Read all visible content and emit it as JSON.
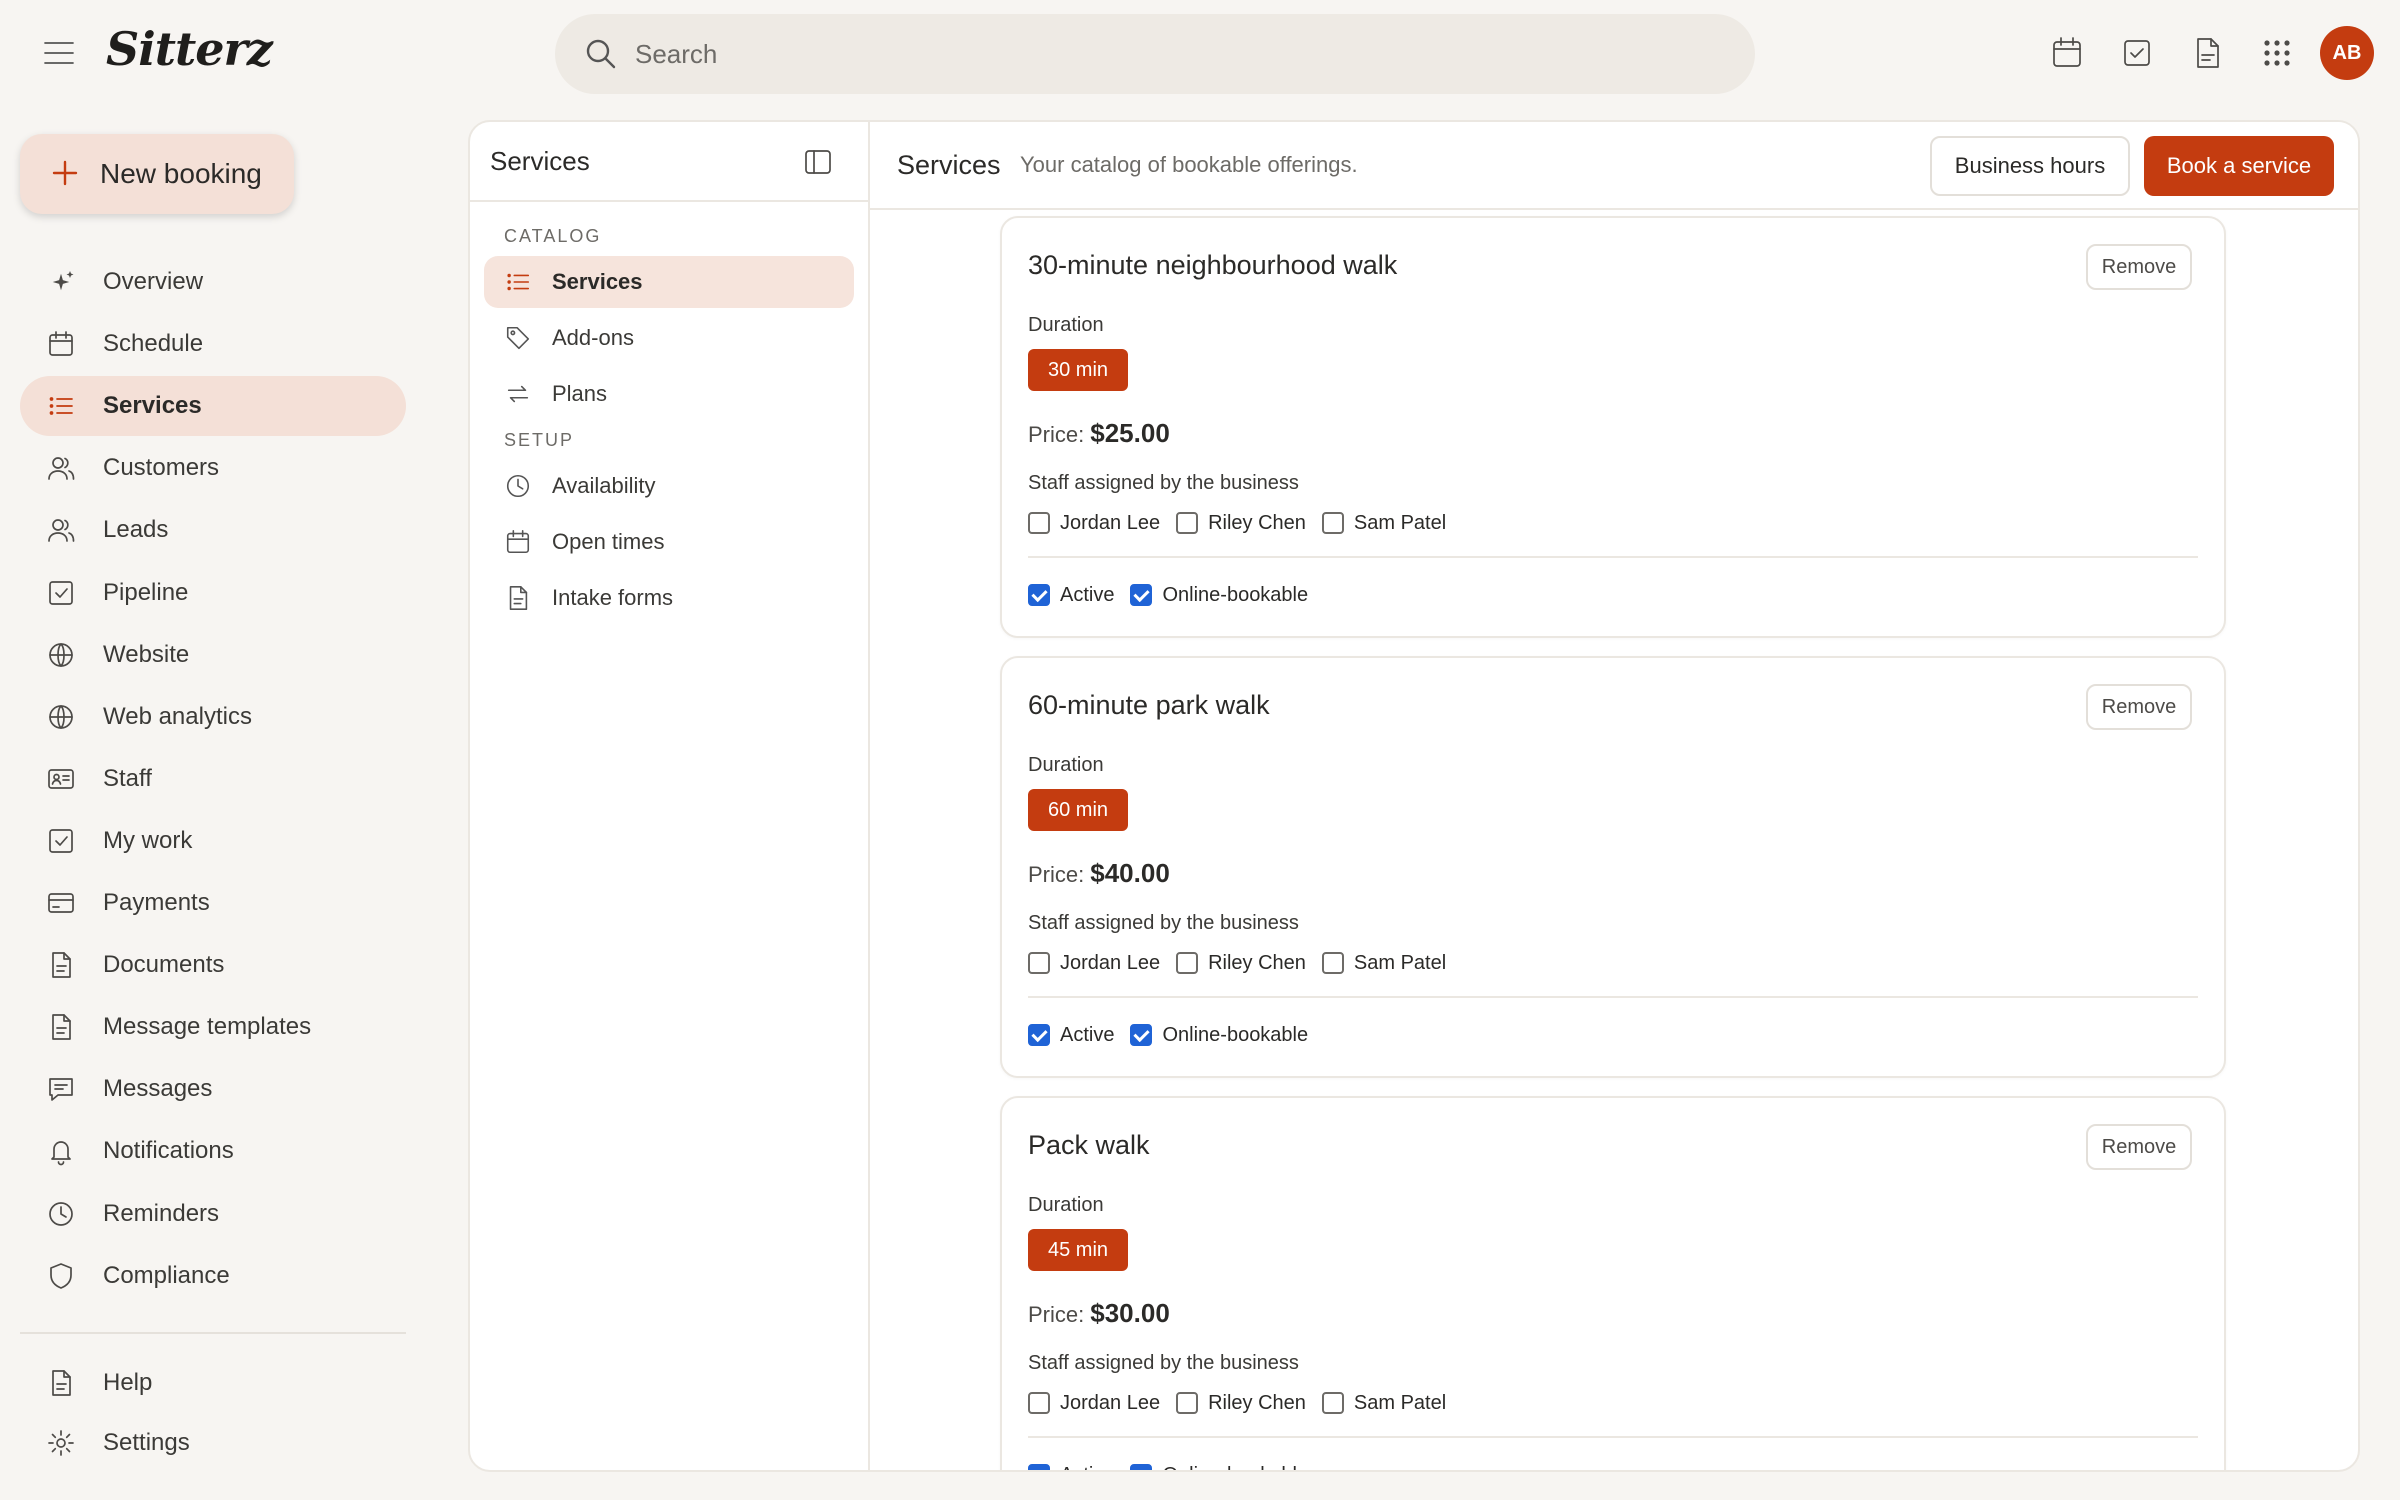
{
  "app": {
    "logo": "Sitterz",
    "user_initials": "AB"
  },
  "colors": {
    "accent": "#c43c10",
    "accent_soft": "#f4e0d7",
    "checkbox_checked": "#1f63d6",
    "background": "#f7f5f2"
  },
  "search": {
    "placeholder": "Search"
  },
  "topbar_icons": [
    "calendar-icon",
    "task-check-icon",
    "document-icon",
    "apps-grid-icon"
  ],
  "new_booking": {
    "label": "New booking"
  },
  "nav": {
    "items": [
      {
        "label": "Overview",
        "icon": "sparkle-icon"
      },
      {
        "label": "Schedule",
        "icon": "calendar-icon"
      },
      {
        "label": "Services",
        "icon": "list-icon",
        "active": true
      },
      {
        "label": "Customers",
        "icon": "people-icon"
      },
      {
        "label": "Leads",
        "icon": "people-icon"
      },
      {
        "label": "Pipeline",
        "icon": "check-square-icon"
      },
      {
        "label": "Website",
        "icon": "globe-icon"
      },
      {
        "label": "Web analytics",
        "icon": "globe-icon"
      },
      {
        "label": "Staff",
        "icon": "id-card-icon"
      },
      {
        "label": "My work",
        "icon": "check-square-icon"
      },
      {
        "label": "Payments",
        "icon": "credit-card-icon"
      },
      {
        "label": "Documents",
        "icon": "document-icon"
      },
      {
        "label": "Message templates",
        "icon": "document-icon"
      },
      {
        "label": "Messages",
        "icon": "message-icon"
      },
      {
        "label": "Notifications",
        "icon": "bell-icon"
      },
      {
        "label": "Reminders",
        "icon": "clock-icon"
      },
      {
        "label": "Compliance",
        "icon": "shield-icon"
      }
    ],
    "footer": [
      {
        "label": "Help",
        "icon": "document-icon"
      },
      {
        "label": "Settings",
        "icon": "gear-icon"
      }
    ]
  },
  "subnav": {
    "title": "Services",
    "sections": [
      {
        "label": "CATALOG",
        "items": [
          {
            "label": "Services",
            "icon": "list-icon",
            "active": true
          },
          {
            "label": "Add-ons",
            "icon": "tag-icon"
          },
          {
            "label": "Plans",
            "icon": "repeat-icon"
          }
        ]
      },
      {
        "label": "SETUP",
        "items": [
          {
            "label": "Availability",
            "icon": "clock-icon"
          },
          {
            "label": "Open times",
            "icon": "calendar-icon"
          },
          {
            "label": "Intake forms",
            "icon": "document-icon"
          }
        ]
      }
    ]
  },
  "content": {
    "title": "Services",
    "subtitle": "Your catalog of bookable offerings.",
    "business_hours_label": "Business hours",
    "book_service_label": "Book a service"
  },
  "labels": {
    "remove": "Remove",
    "duration": "Duration",
    "price": "Price:",
    "staff": "Staff assigned by the business",
    "active": "Active",
    "online_bookable": "Online-bookable"
  },
  "services": [
    {
      "name": "30-minute neighbourhood walk",
      "duration": "30 min",
      "price": "$25.00",
      "staff": [
        {
          "name": "Jordan Lee",
          "checked": false
        },
        {
          "name": "Riley Chen",
          "checked": false
        },
        {
          "name": "Sam Patel",
          "checked": false
        }
      ],
      "active": true,
      "online_bookable": true
    },
    {
      "name": "60-minute park walk",
      "duration": "60 min",
      "price": "$40.00",
      "staff": [
        {
          "name": "Jordan Lee",
          "checked": false
        },
        {
          "name": "Riley Chen",
          "checked": false
        },
        {
          "name": "Sam Patel",
          "checked": false
        }
      ],
      "active": true,
      "online_bookable": true
    },
    {
      "name": "Pack walk",
      "duration": "45 min",
      "price": "$30.00",
      "staff": [
        {
          "name": "Jordan Lee",
          "checked": false
        },
        {
          "name": "Riley Chen",
          "checked": false
        },
        {
          "name": "Sam Patel",
          "checked": false
        }
      ],
      "active": true,
      "online_bookable": true
    }
  ]
}
